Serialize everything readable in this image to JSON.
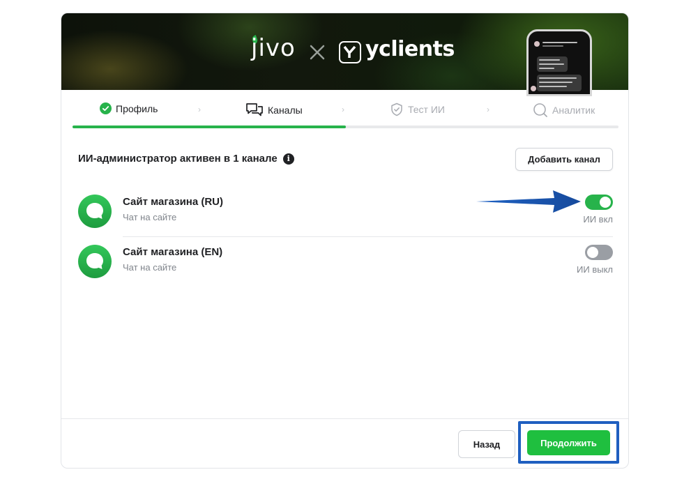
{
  "banner": {
    "brand_left": "jivo",
    "brand_right": "yclients"
  },
  "steps": [
    {
      "label": "Профиль",
      "state": "done",
      "icon": "check-circle-icon"
    },
    {
      "label": "Каналы",
      "state": "active",
      "icon": "chat-bubbles-icon"
    },
    {
      "label": "Тест ИИ",
      "state": "pending",
      "icon": "shield-check-icon"
    },
    {
      "label": "Аналитик",
      "state": "pending",
      "icon": "search-icon"
    }
  ],
  "progress": {
    "completed_fraction": 0.5
  },
  "main": {
    "title": "ИИ-администратор активен в 1 канале",
    "add_channel_label": "Добавить канал"
  },
  "channels": [
    {
      "name": "Сайт магазина (RU)",
      "type": "Чат на сайте",
      "ai_enabled": true,
      "status_label": "ИИ вкл"
    },
    {
      "name": "Сайт магазина (EN)",
      "type": "Чат на сайте",
      "ai_enabled": false,
      "status_label": "ИИ выкл"
    }
  ],
  "footer": {
    "back_label": "Назад",
    "continue_label": "Продолжить"
  },
  "colors": {
    "accent_green": "#27b34b",
    "button_green": "#1fbf3f",
    "highlight_blue": "#1f5fc0",
    "arrow_blue": "#1a56b8"
  }
}
